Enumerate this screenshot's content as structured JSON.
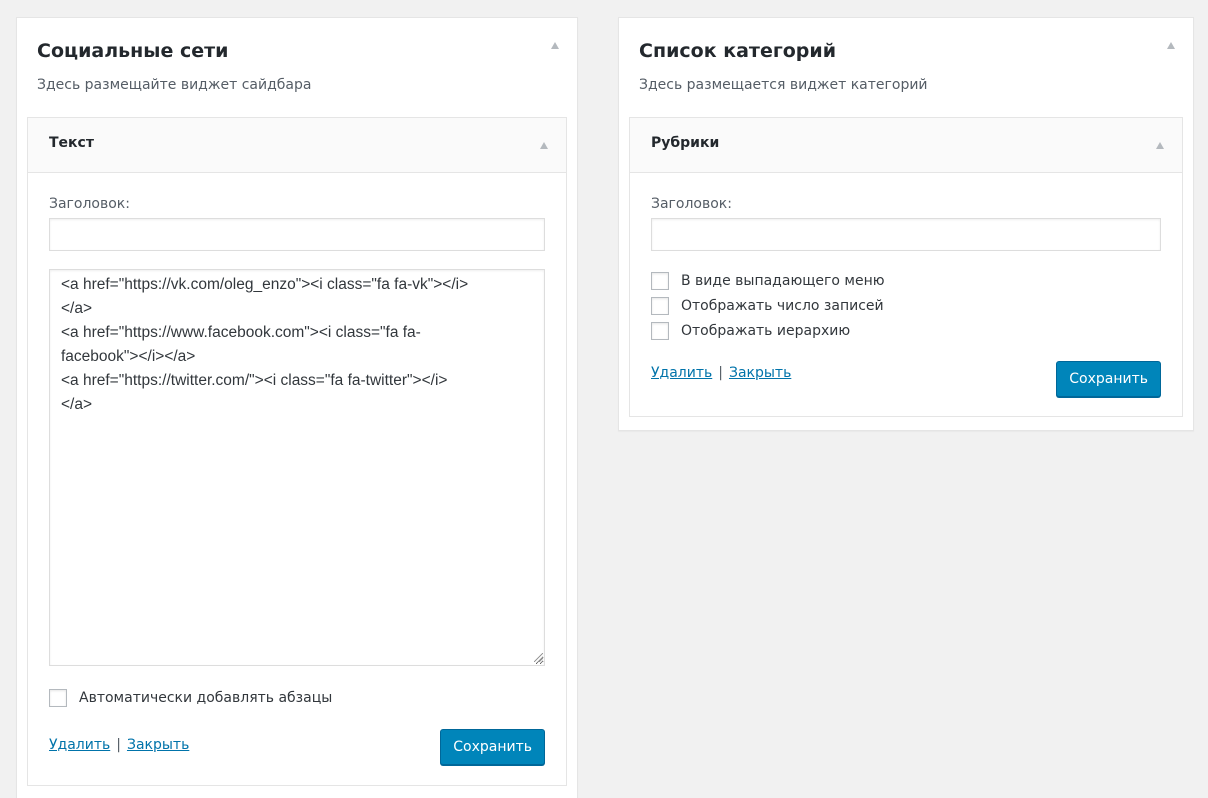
{
  "colors": {
    "background": "#f1f1f1",
    "accent": "#0085ba",
    "link": "#0073aa"
  },
  "social_panel": {
    "title": "Социальные сети",
    "description": "Здесь размещайте виджет сайдбара",
    "widget": {
      "title": "Текст",
      "title_label": "Заголовок:",
      "title_value": "",
      "content": "<a href=\"https://vk.com/oleg_enzo\"><i class=\"fa fa-vk\"></i>\n</a>\n<a href=\"https://www.facebook.com\"><i class=\"fa fa-\nfacebook\"></i></a>\n<a href=\"https://twitter.com/\"><i class=\"fa fa-twitter\"></i>\n</a>",
      "auto_paragraph_label": "Автоматически добавлять абзацы",
      "delete_label": "Удалить",
      "separator": "|",
      "close_label": "Закрыть",
      "save_label": "Сохранить"
    }
  },
  "category_panel": {
    "title": "Список категорий",
    "description": "Здесь размещается виджет категорий",
    "widget": {
      "title": "Рубрики",
      "title_label": "Заголовок:",
      "title_value": "",
      "options": [
        {
          "label": "В виде выпадающего меню"
        },
        {
          "label": "Отображать число записей"
        },
        {
          "label": "Отображать иерархию"
        }
      ],
      "delete_label": "Удалить",
      "separator": "|",
      "close_label": "Закрыть",
      "save_label": "Сохранить"
    }
  }
}
